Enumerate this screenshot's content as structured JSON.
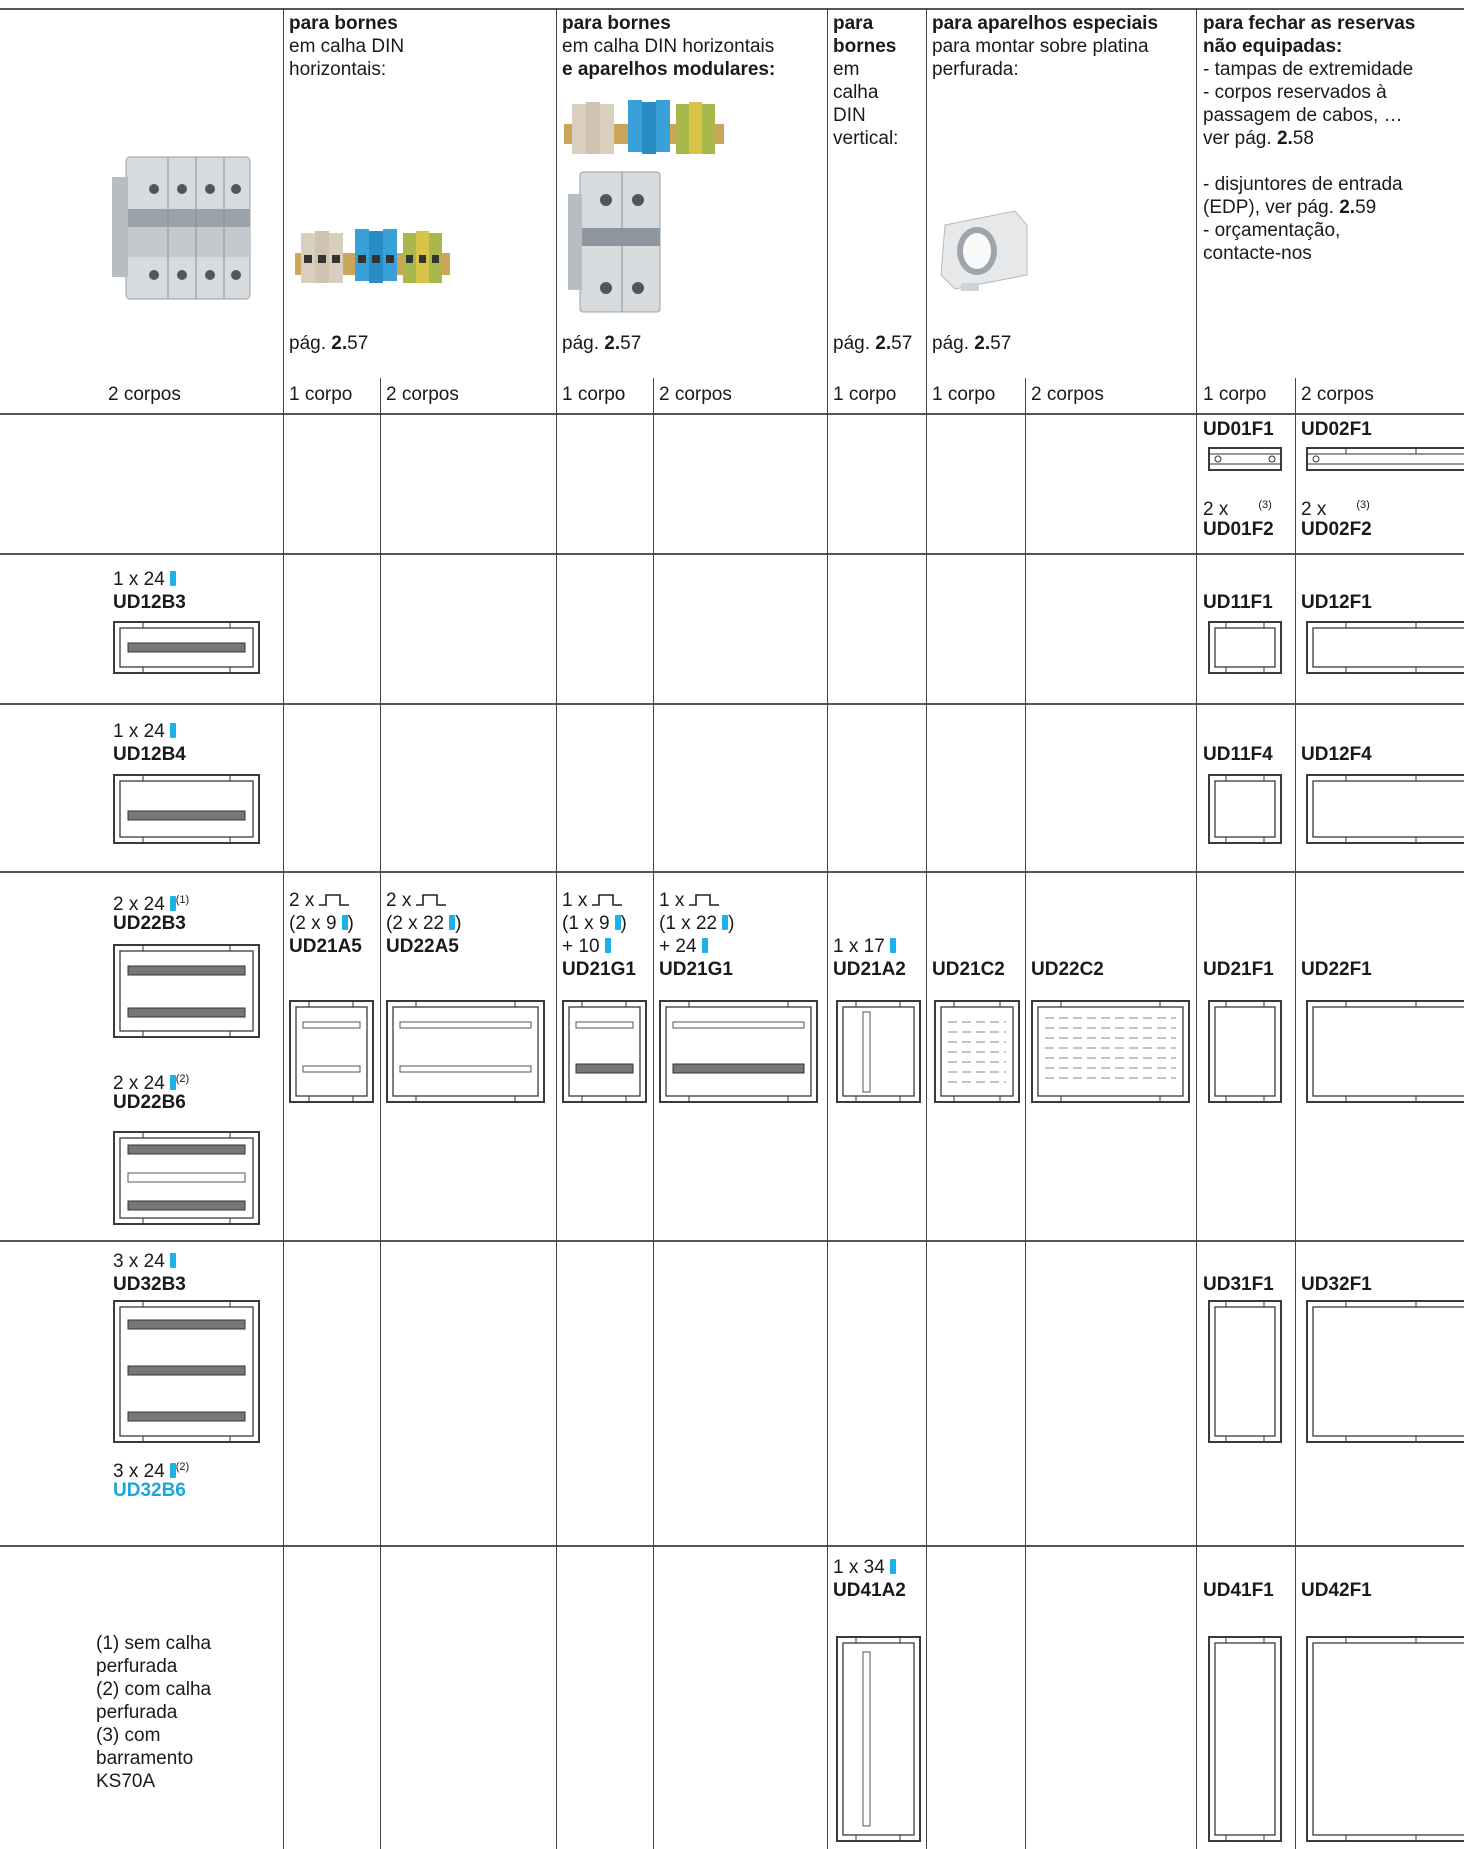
{
  "header": {
    "col_terminals_h": {
      "title": "para bornes",
      "lines": [
        "em calha DIN",
        "horizontais:"
      ],
      "page_prefix": "pág. ",
      "page_bold": "2.",
      "page_num": "57"
    },
    "col_terminals_mod": {
      "title": "para bornes",
      "line1": "em calha DIN   horizontais",
      "line2_bold": "e aparelhos modulares:",
      "page_prefix": "pág. ",
      "page_bold": "2.",
      "page_num": "57"
    },
    "col_terminals_v": {
      "title_lines": [
        "para",
        "bornes"
      ],
      "lines": [
        "em",
        "calha",
        "DIN",
        "vertical:"
      ],
      "page_prefix": "pág. ",
      "page_bold": "2.",
      "page_num": "57"
    },
    "col_special": {
      "title": "para aparelhos especiais",
      "lines": [
        "para montar sobre platina",
        "perfurada:"
      ],
      "page_prefix": "pág. ",
      "page_bold": "2.",
      "page_num": "57"
    },
    "col_close": {
      "title_lines": [
        "para fechar as reservas",
        "não equipadas:"
      ],
      "lines": [
        "- tampas de extremidade",
        "- corpos reservados à",
        "passagem de cabos, …"
      ],
      "ref1_prefix": "ver pág. ",
      "ref1_bold": "2.",
      "ref1_num": "58",
      "line_edp1": "- disjuntores de entrada",
      "line_edp2_prefix": "(EDP), ver pág. ",
      "line_edp2_bold": "2.",
      "line_edp2_num": "59",
      "line_quote1": "- orçamentação,",
      "line_quote2": "contacte-nos"
    },
    "bodies": {
      "c1": "2 corpos",
      "c2": "1 corpo",
      "c3": "2 corpos",
      "c4": "1 corpo",
      "c5": "2 corpos",
      "c6": "1 corpo",
      "c7": "1 corpo",
      "c8": "2 corpos",
      "c9": "1 corpo",
      "c10": "2 corpos"
    }
  },
  "rows": {
    "r1": {
      "close1": "UD01F1",
      "close2": "UD02F1",
      "pre1": "2 x",
      "pre2": "2 x",
      "sup": "(3)",
      "close1b": "UD01F2",
      "close2b": "UD02F2"
    },
    "r2": {
      "qty": "1 x 24",
      "code": "UD12B3",
      "close1": "UD11F1",
      "close2": "UD12F1"
    },
    "r3": {
      "qty": "1 x 24",
      "code": "UD12B4",
      "close1": "UD11F4",
      "close2": "UD12F4"
    },
    "r4": {
      "qty1": "2 x 24",
      "sup1": "(1)",
      "code1": "UD22B3",
      "qty2": "2 x 24",
      "sup2": "(2)",
      "code2": "UD22B6",
      "a5_line1": "2 x",
      "a5_line2": "(2 x 9",
      "a5_code": "UD21A5",
      "b5_line1": "2 x",
      "b5_line2": "(2 x 22",
      "b5_code": "UD22A5",
      "g1_line1": "1 x",
      "g1_line2": "(1 x 9",
      "g1_line3": "+ 10",
      "g1_code": "UD21G1",
      "g2_line1": "1 x",
      "g2_line2": "(1 x 22",
      "g2_line3": "+ 24",
      "g2_code": "UD21G1",
      "close_paren": ")",
      "a2_qty": "1 x 17",
      "a2_code": "UD21A2",
      "c2_code": "UD21C2",
      "c2b_code": "UD22C2",
      "close1": "UD21F1",
      "close2": "UD22F1"
    },
    "r5": {
      "qty1": "3 x 24",
      "code1": "UD32B3",
      "qty2": "3 x 24",
      "sup2": "(2)",
      "code2": "UD32B6",
      "close1": "UD31F1",
      "close2": "UD32F1"
    },
    "r6": {
      "notes": [
        "(1) sem calha",
        "perfurada",
        "(2) com calha",
        "perfurada",
        "(3) com",
        "barramento",
        "KS70A"
      ],
      "a2_qty": "1 x 34",
      "a2_code": "UD41A2",
      "close1": "UD41F1",
      "close2": "UD42F1"
    }
  },
  "colors": {
    "accent": "#1ab2e8",
    "accent_text": "#1aa7d8",
    "rule": "#444444"
  }
}
